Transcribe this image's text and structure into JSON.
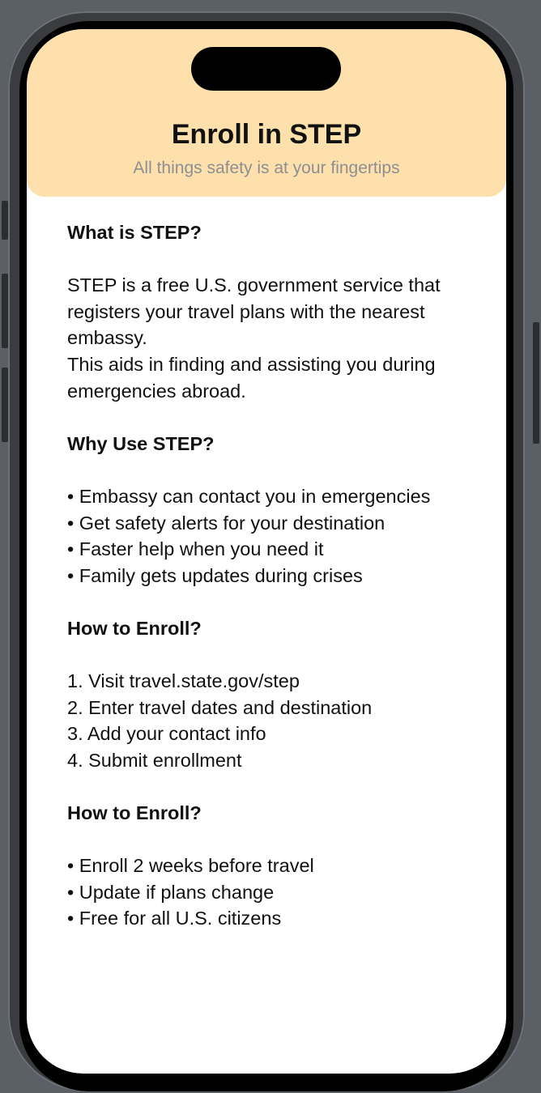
{
  "header": {
    "title": "Enroll in STEP",
    "subtitle": "All things safety is at your fingertips",
    "background_color": "#fde0ab"
  },
  "sections": [
    {
      "heading": "What is STEP?",
      "lines": [
        "STEP is a free U.S. government service that",
        "registers your travel plans with the nearest",
        "embassy.",
        "This aids in finding and assisting you during",
        "emergencies abroad."
      ]
    },
    {
      "heading": "Why Use STEP?",
      "lines": [
        "• Embassy can contact you in emergencies",
        "• Get safety alerts for your destination",
        "• Faster help when you need it",
        "• Family gets updates during crises"
      ]
    },
    {
      "heading": "How to Enroll?",
      "lines": [
        "1. Visit travel.state.gov/step",
        "2. Enter travel dates and destination",
        "3. Add your contact info",
        "4. Submit enrollment"
      ]
    },
    {
      "heading": "How to Enroll?",
      "lines": [
        "• Enroll 2 weeks before travel",
        "• Update if plans change",
        "• Free for all U.S. citizens"
      ]
    }
  ]
}
